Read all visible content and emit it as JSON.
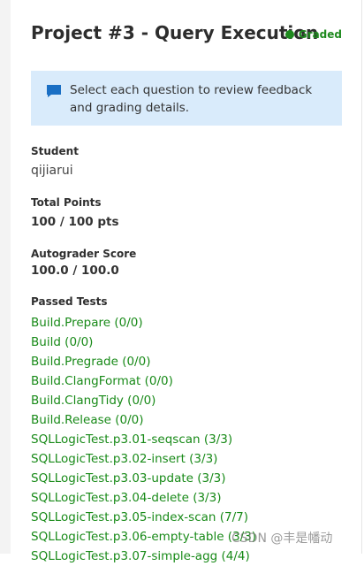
{
  "header": {
    "title": "Project #3 - Query Execution",
    "status_label": "Graded",
    "status_color": "#1f8a1f"
  },
  "notice": {
    "icon": "comment-icon",
    "text": "Select each question to review feedback and grading details."
  },
  "student": {
    "label": "Student",
    "value": "qijiarui"
  },
  "total_points": {
    "label": "Total Points",
    "value": "100 / 100 pts"
  },
  "autograder": {
    "label": "Autograder Score",
    "value": "100.0 / 100.0"
  },
  "passed_tests": {
    "label": "Passed Tests",
    "items": [
      "Build.Prepare (0/0)",
      "Build (0/0)",
      "Build.Pregrade (0/0)",
      "Build.ClangFormat (0/0)",
      "Build.ClangTidy (0/0)",
      "Build.Release (0/0)",
      "SQLLogicTest.p3.01-seqscan (3/3)",
      "SQLLogicTest.p3.02-insert (3/3)",
      "SQLLogicTest.p3.03-update (3/3)",
      "SQLLogicTest.p3.04-delete (3/3)",
      "SQLLogicTest.p3.05-index-scan (7/7)",
      "SQLLogicTest.p3.06-empty-table (3/3)",
      "SQLLogicTest.p3.07-simple-agg (4/4)"
    ]
  },
  "watermark": "CSDN @丰是幡动",
  "colors": {
    "link": "#188a18",
    "notice_bg": "#d9ebfb",
    "accent_blue": "#1a6fc4"
  }
}
